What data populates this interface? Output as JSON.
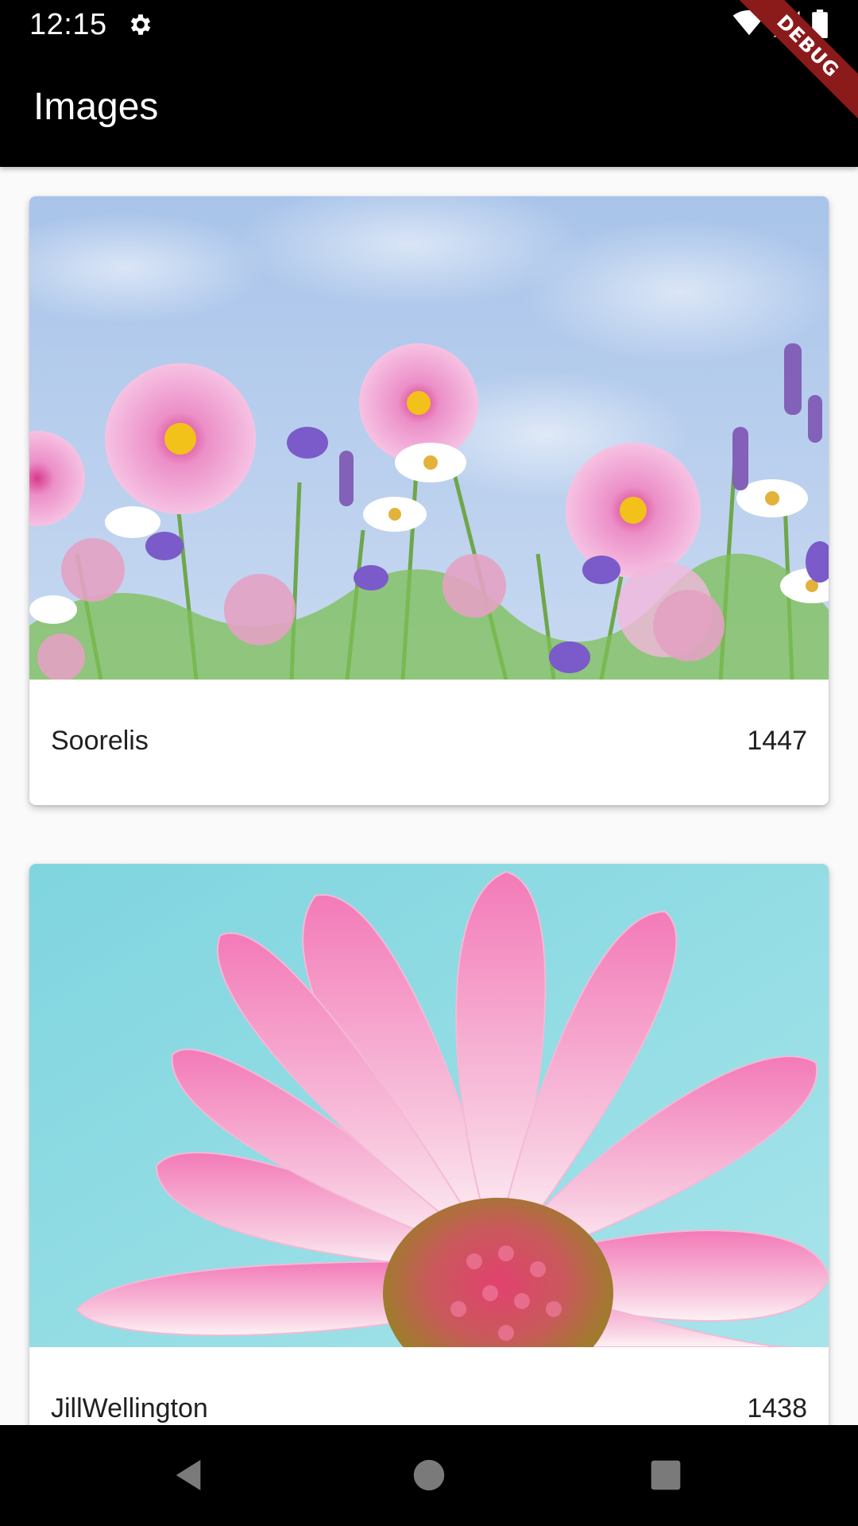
{
  "status_bar": {
    "time": "12:15",
    "icons": [
      "gear-icon",
      "wifi-icon",
      "signal-icon",
      "battery-icon"
    ]
  },
  "app_bar": {
    "title": "Images"
  },
  "debug_banner": {
    "label": "DEBUG"
  },
  "cards": [
    {
      "author": "Soorelis",
      "count": "1447",
      "image": "wildflowers-photo"
    },
    {
      "author": "JillWellington",
      "count": "1438",
      "image": "pink-daisy-photo"
    }
  ],
  "nav_bar": {
    "icons": [
      "back-icon",
      "home-icon",
      "recents-icon"
    ]
  },
  "colors": {
    "app_bar": "#000000",
    "background": "#fafafa",
    "card": "#ffffff",
    "debug_ribbon": "#8b1a1a"
  }
}
